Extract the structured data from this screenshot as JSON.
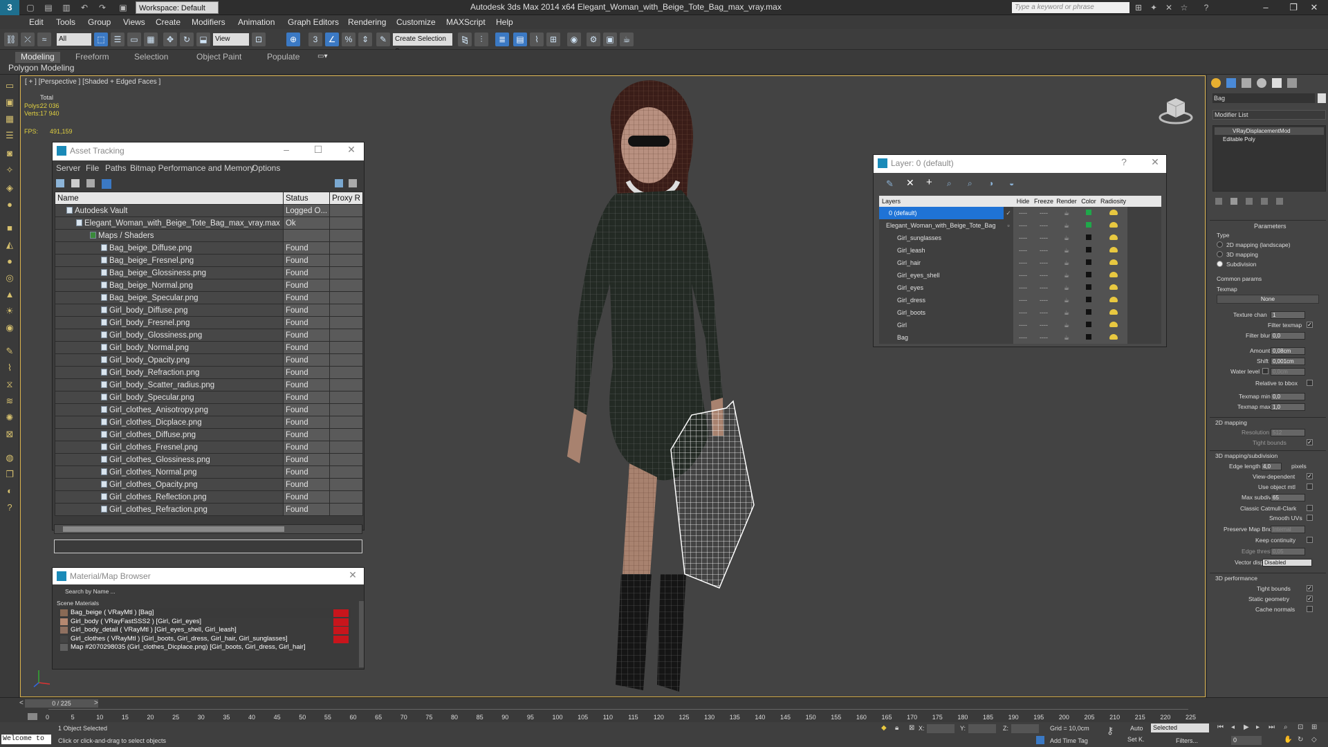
{
  "titlebar": {
    "workspace": "Workspace: Default",
    "title": "Autodesk 3ds Max  2014 x64     Elegant_Woman_with_Beige_Tote_Bag_max_vray.max",
    "search_placeholder": "Type a keyword or phrase"
  },
  "menu": [
    "Edit",
    "Tools",
    "Group",
    "Views",
    "Create",
    "Modifiers",
    "Animation",
    "Graph Editors",
    "Rendering",
    "Customize",
    "MAXScript",
    "Help"
  ],
  "toolbar": {
    "filter": "All",
    "refcoord": "View",
    "named_sel": "Create Selection S"
  },
  "ribbon": {
    "tabs": [
      "Modeling",
      "Freeform",
      "Selection",
      "Object Paint",
      "Populate"
    ],
    "sub": "Polygon Modeling"
  },
  "viewport": {
    "label": "[ + ] [Perspective ] [Shaded + Edged Faces ]",
    "stats": {
      "total": "Total",
      "polys_label": "Polys:",
      "polys": "22 036",
      "verts_label": "Verts:",
      "verts": "17 940",
      "fps_label": "FPS:",
      "fps": "491,159"
    }
  },
  "asset": {
    "title": "Asset Tracking",
    "menus": [
      "Server",
      "File",
      "Paths",
      "Bitmap Performance and Memory",
      "Options"
    ],
    "headers": [
      "Name",
      "Status",
      "Proxy R"
    ],
    "vault": "Autodesk Vault",
    "vault_status": "Logged O...",
    "file": "Elegant_Woman_with_Beige_Tote_Bag_max_vray.max",
    "file_status": "Ok",
    "folder": "Maps / Shaders",
    "found": "Found",
    "maps": [
      "Bag_beige_Diffuse.png",
      "Bag_beige_Fresnel.png",
      "Bag_beige_Glossiness.png",
      "Bag_beige_Normal.png",
      "Bag_beige_Specular.png",
      "Girl_body_Diffuse.png",
      "Girl_body_Fresnel.png",
      "Girl_body_Glossiness.png",
      "Girl_body_Normal.png",
      "Girl_body_Opacity.png",
      "Girl_body_Refraction.png",
      "Girl_body_Scatter_radius.png",
      "Girl_body_Specular.png",
      "Girl_clothes_Anisotropy.png",
      "Girl_clothes_Dicplace.png",
      "Girl_clothes_Diffuse.png",
      "Girl_clothes_Fresnel.png",
      "Girl_clothes_Glossiness.png",
      "Girl_clothes_Normal.png",
      "Girl_clothes_Opacity.png",
      "Girl_clothes_Reflection.png",
      "Girl_clothes_Refraction.png"
    ]
  },
  "matbrowser": {
    "title": "Material/Map Browser",
    "search": "Search by Name ...",
    "section": "Scene Materials",
    "items": [
      "Bag_beige  ( VRayMtl ) [Bag]",
      "Girl_body  ( VRayFastSSS2 ) [Girl, Girl_eyes]",
      "Girl_body_detail  ( VRayMtl ) [Girl_eyes_shell, Girl_leash]",
      "Girl_clothes  ( VRayMtl ) [Girl_boots, Girl_dress, Girl_hair, Girl_sunglasses]",
      "Map #2070298035 (Girl_clothes_Dicplace.png) [Girl_boots, Girl_dress, Girl_hair]"
    ]
  },
  "layers": {
    "title": "Layer: 0 (default)",
    "headers": [
      "Layers",
      "Hide",
      "Freeze",
      "Render",
      "Color",
      "Radiosity"
    ],
    "rows": [
      "0 (default)",
      "Elegant_Woman_with_Beige_Tote_Bag",
      "Girl_sunglasses",
      "Girl_leash",
      "Girl_hair",
      "Girl_eyes_shell",
      "Girl_eyes",
      "Girl_dress",
      "Girl_boots",
      "Girl",
      "Bag"
    ],
    "dash": "----"
  },
  "cmd": {
    "name": "Bag",
    "modlist": "Modifier List",
    "stack": [
      "VRayDisplacementMod",
      "Editable Poly"
    ],
    "params_title": "Parameters",
    "type_label": "Type",
    "types": [
      "2D mapping (landscape)",
      "3D mapping",
      "Subdivision"
    ],
    "common": "Common params",
    "texmap": "Texmap",
    "none": "None",
    "texture_chan": "Texture chan",
    "texture_chan_val": "1",
    "filter_texmap": "Filter texmap",
    "filter_blur": "Filter blur",
    "filter_blur_val": "0,0",
    "amount": "Amount",
    "amount_val": "0,08cm",
    "shift": "Shift",
    "shift_val": "0,001cm",
    "water": "Water level",
    "water_val": "0,0cm",
    "relative": "Relative to bbox",
    "texmin": "Texmap min",
    "texmin_val": "0,0",
    "texmax": "Texmap max",
    "texmax_val": "1,0",
    "map2d": "2D mapping",
    "resolution": "Resolution",
    "resolution_val": "512",
    "tight": "Tight bounds",
    "map3d": "3D mapping/subdivision",
    "edge": "Edge length",
    "edge_val": "4,0",
    "pixels": "pixels",
    "viewdep": "View-dependent",
    "useobj": "Use object mtl",
    "maxsub": "Max subdivs",
    "maxsub_val": "65",
    "catmull": "Classic Catmull-Clark",
    "smooth": "Smooth UVs",
    "preserve": "Preserve Map Bnd",
    "preserve_val": "Internal",
    "keep": "Keep continuity",
    "edgethresh": "Edge thresh",
    "edgethresh_val": "0,05",
    "vector": "Vector displ",
    "vector_val": "Disabled",
    "perf": "3D performance",
    "tight2": "Tight bounds",
    "static": "Static geometry",
    "cache": "Cache normals"
  },
  "timeline": {
    "frame": "0 / 225",
    "ticks": [
      "0",
      "5",
      "10",
      "15",
      "20",
      "25",
      "30",
      "35",
      "40",
      "45",
      "50",
      "55",
      "60",
      "65",
      "70",
      "75",
      "80",
      "85",
      "90",
      "95",
      "100",
      "105",
      "110",
      "115",
      "120",
      "125",
      "130",
      "135",
      "140",
      "145",
      "150",
      "155",
      "160",
      "165",
      "170",
      "175",
      "180",
      "185",
      "190",
      "195",
      "200",
      "205",
      "210",
      "215",
      "220",
      "225"
    ]
  },
  "status": {
    "welcome": "Welcome to",
    "selected": "1 Object Selected",
    "hint": "Click or click-and-drag to select objects",
    "x": "X:",
    "y": "Y:",
    "z": "Z:",
    "grid": "Grid = 10,0cm",
    "addtime": "Add Time Tag",
    "auto": "Auto",
    "setk": "Set K.",
    "selmode": "Selected",
    "filters": "Filters...",
    "frame": "0"
  }
}
